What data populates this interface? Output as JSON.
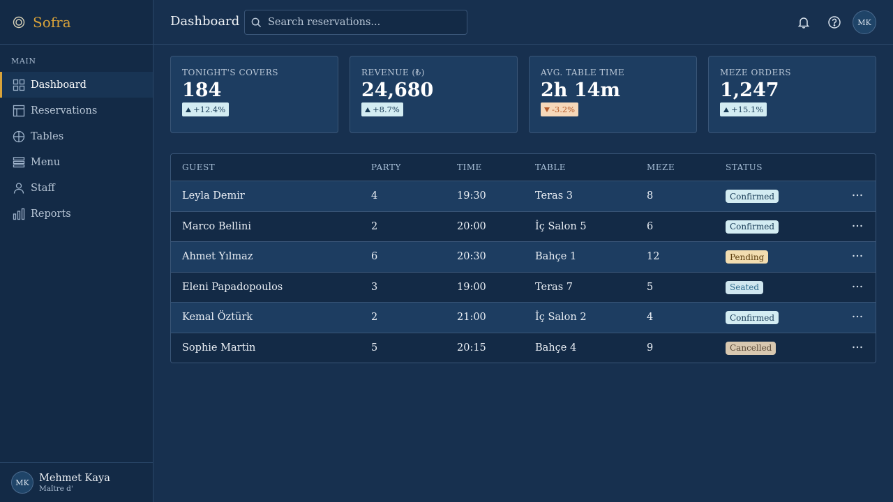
{
  "brand": {
    "name": "Sofra",
    "icon": "olive-ring-icon",
    "accent": "#d9a33a"
  },
  "sidebar": {
    "section_label": "MAIN",
    "items": [
      {
        "label": "Dashboard",
        "icon": "grid-icon",
        "active": true
      },
      {
        "label": "Reservations",
        "icon": "calendar-table-icon",
        "active": false
      },
      {
        "label": "Tables",
        "icon": "table-circle-icon",
        "active": false
      },
      {
        "label": "Menu",
        "icon": "menu-list-icon",
        "active": false
      },
      {
        "label": "Staff",
        "icon": "user-icon",
        "active": false
      },
      {
        "label": "Reports",
        "icon": "bar-chart-icon",
        "active": false
      }
    ],
    "user": {
      "initials": "MK",
      "name": "Mehmet Kaya",
      "role": "Maître d'"
    }
  },
  "header": {
    "title": "Dashboard",
    "search_placeholder": "Search reservations...",
    "avatar_initials": "MK"
  },
  "stats": [
    {
      "label": "TONIGHT'S COVERS",
      "value": "184",
      "delta": "+12.4%",
      "trend": "up"
    },
    {
      "label": "REVENUE (₺)",
      "value": "24,680",
      "delta": "+8.7%",
      "trend": "up"
    },
    {
      "label": "AVG. TABLE TIME",
      "value": "2h 14m",
      "delta": "-3.2%",
      "trend": "down"
    },
    {
      "label": "MEZE ORDERS",
      "value": "1,247",
      "delta": "+15.1%",
      "trend": "up"
    }
  ],
  "table": {
    "columns": [
      "GUEST",
      "PARTY",
      "TIME",
      "TABLE",
      "MEZE",
      "STATUS"
    ],
    "rows": [
      {
        "guest": "Leyla Demir",
        "party": "4",
        "time": "19:30",
        "table": "Teras 3",
        "meze": "8",
        "status": "Confirmed"
      },
      {
        "guest": "Marco Bellini",
        "party": "2",
        "time": "20:00",
        "table": "İç Salon 5",
        "meze": "6",
        "status": "Confirmed"
      },
      {
        "guest": "Ahmet Yılmaz",
        "party": "6",
        "time": "20:30",
        "table": "Bahçe 1",
        "meze": "12",
        "status": "Pending"
      },
      {
        "guest": "Eleni Papadopoulos",
        "party": "3",
        "time": "19:00",
        "table": "Teras 7",
        "meze": "5",
        "status": "Seated"
      },
      {
        "guest": "Kemal Öztürk",
        "party": "2",
        "time": "21:00",
        "table": "İç Salon 2",
        "meze": "4",
        "status": "Confirmed"
      },
      {
        "guest": "Sophie Martin",
        "party": "5",
        "time": "20:15",
        "table": "Bahçe 4",
        "meze": "9",
        "status": "Cancelled"
      }
    ]
  }
}
